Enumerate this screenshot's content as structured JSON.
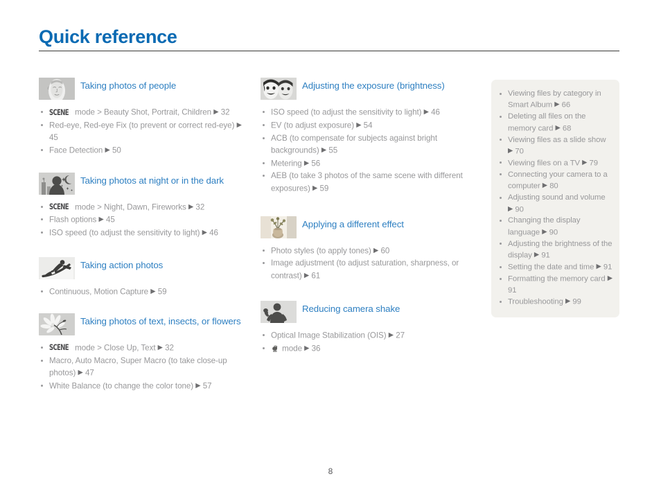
{
  "page": {
    "title": "Quick reference",
    "number": "8",
    "accent_title_color": "#0a6ab3",
    "accent_heading_color": "#2f80c2",
    "body_text_color": "#98989a",
    "sidebar_bg_color": "#f2f1ed"
  },
  "arrow": "▶",
  "columns": {
    "left": [
      {
        "icon": "portrait-face-icon",
        "title": "Taking photos of people",
        "items": [
          {
            "scene": "SCENE",
            "text": " mode > Beauty Shot, Portrait, Children ",
            "page": "32"
          },
          {
            "text": "Red-eye, Red-eye Fix (to prevent or correct red-eye) ",
            "page": "45"
          },
          {
            "text": "Face Detection ",
            "page": "50"
          }
        ]
      },
      {
        "icon": "night-scene-icon",
        "title": "Taking photos at night or in the dark",
        "items": [
          {
            "scene": "SCENE",
            "text": " mode > Night, Dawn, Fireworks ",
            "page": "32"
          },
          {
            "text": "Flash options ",
            "page": "45"
          },
          {
            "text": "ISO speed (to adjust the sensitivity to light) ",
            "page": "46"
          }
        ]
      },
      {
        "icon": "snowboarder-action-icon",
        "title": "Taking action photos",
        "items": [
          {
            "text": "Continuous, Motion Capture ",
            "page": "59"
          }
        ]
      },
      {
        "icon": "flower-macro-icon",
        "title": "Taking photos of text, insects, or flowers",
        "items": [
          {
            "scene": "SCENE",
            "text": " mode > Close Up, Text ",
            "page": "32"
          },
          {
            "text": "Macro, Auto Macro, Super Macro (to take close-up photos) ",
            "page": "47"
          },
          {
            "text": "White Balance (to change the color tone) ",
            "page": "57"
          }
        ]
      }
    ],
    "middle": [
      {
        "icon": "two-faces-exposure-icon",
        "title": "Adjusting the exposure (brightness)",
        "items": [
          {
            "text": "ISO speed (to adjust the sensitivity to light) ",
            "page": "46"
          },
          {
            "text": "EV (to adjust exposure) ",
            "page": "54"
          },
          {
            "text": "ACB (to compensate for subjects against bright backgrounds) ",
            "page": "55"
          },
          {
            "text": "Metering ",
            "page": "56"
          },
          {
            "text": "AEB (to take 3 photos of the same scene with different exposures) ",
            "page": "59"
          }
        ]
      },
      {
        "icon": "vase-flowers-effect-icon",
        "title": "Applying a different effect",
        "items": [
          {
            "text": "Photo styles (to apply tones) ",
            "page": "60"
          },
          {
            "text": "Image adjustment (to adjust saturation, sharpness, or contrast) ",
            "page": "61"
          }
        ]
      },
      {
        "icon": "person-camera-shake-icon",
        "title": "Reducing camera shake",
        "items": [
          {
            "text": "Optical Image Stabilization (OIS) ",
            "page": "27"
          },
          {
            "glyph": "dual-is-hand-icon",
            "text": " mode ",
            "page": "36"
          }
        ]
      }
    ],
    "right": {
      "items": [
        {
          "text": "Viewing files by category in Smart Album ",
          "page": "66"
        },
        {
          "text": "Deleting all files on the memory card ",
          "page": "68"
        },
        {
          "text": "Viewing files as a slide show ",
          "page": "70"
        },
        {
          "text": "Viewing files on a TV ",
          "page": "79"
        },
        {
          "text": "Connecting your camera to a computer ",
          "page": "80"
        },
        {
          "text": "Adjusting sound and volume ",
          "page": "90"
        },
        {
          "text": "Changing the display language ",
          "page": "90"
        },
        {
          "text": "Adjusting the brightness of the display ",
          "page": "91"
        },
        {
          "text": "Setting the date and time ",
          "page": "91"
        },
        {
          "text": "Formatting the memory card ",
          "page": "91"
        },
        {
          "text": "Troubleshooting ",
          "page": "99"
        }
      ]
    }
  }
}
